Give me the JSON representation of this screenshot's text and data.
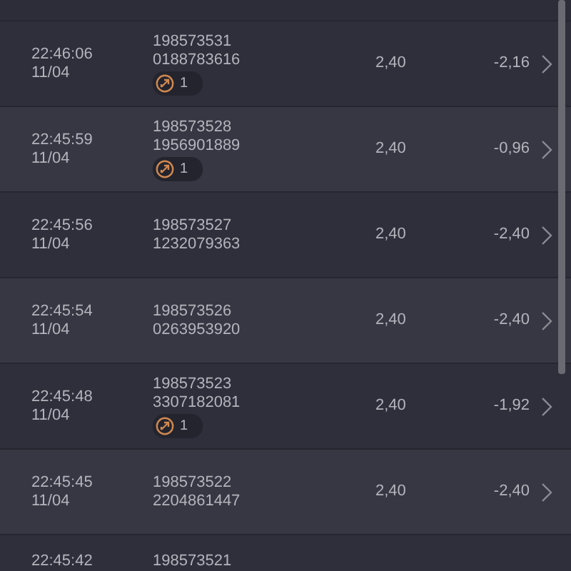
{
  "rows": [
    {
      "time": "22:46:06",
      "date": "11/04",
      "id1": "198573531",
      "id2": "0188783616",
      "badge": "1",
      "stake": "2,40",
      "result": "-2,16"
    },
    {
      "time": "22:45:59",
      "date": "11/04",
      "id1": "198573528",
      "id2": "1956901889",
      "badge": "1",
      "stake": "2,40",
      "result": "-0,96"
    },
    {
      "time": "22:45:56",
      "date": "11/04",
      "id1": "198573527",
      "id2": "1232079363",
      "stake": "2,40",
      "result": "-2,40"
    },
    {
      "time": "22:45:54",
      "date": "11/04",
      "id1": "198573526",
      "id2": "0263953920",
      "stake": "2,40",
      "result": "-2,40"
    },
    {
      "time": "22:45:48",
      "date": "11/04",
      "id1": "198573523",
      "id2": "3307182081",
      "badge": "1",
      "stake": "2,40",
      "result": "-1,92"
    },
    {
      "time": "22:45:45",
      "date": "11/04",
      "id1": "198573522",
      "id2": "2204861447",
      "stake": "2,40",
      "result": "-2,40"
    },
    {
      "time": "22:45:42",
      "id1": "198573521"
    }
  ]
}
